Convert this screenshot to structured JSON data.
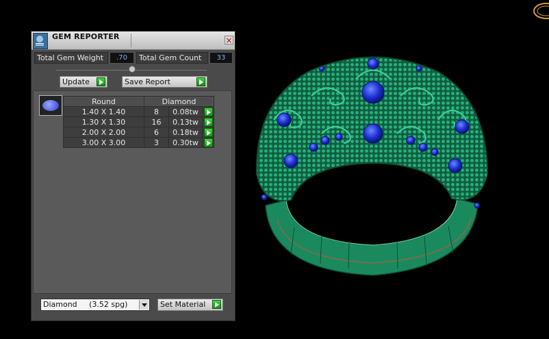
{
  "panel": {
    "title": "GEM REPORTER",
    "close_label": "×",
    "total_weight_label": "Total Gem Weight",
    "total_weight_value": ".70",
    "total_count_label": "Total Gem Count",
    "total_count_value": "33",
    "update_label": "Update",
    "save_report_label": "Save Report",
    "table": {
      "headers": [
        "Round",
        "Diamond"
      ],
      "rows": [
        {
          "size": "1.40 X 1.40",
          "count": "8",
          "weight": "0.08tw"
        },
        {
          "size": "1.30 X 1.30",
          "count": "16",
          "weight": "0.13tw"
        },
        {
          "size": "2.00 X 2.00",
          "count": "6",
          "weight": "0.18tw"
        },
        {
          "size": "3.00 X 3.00",
          "count": "3",
          "weight": "0.30tw"
        }
      ]
    },
    "material_selected": "Diamond     (3.52 spg)",
    "set_material_label": "Set Material"
  },
  "colors": {
    "ring_green": "#1f9a6a",
    "gem_blue": "#1a2fd0",
    "go_green": "#22a322",
    "value_text": "#7fb3ff"
  },
  "icons": {
    "title": "gem-reporter-icon",
    "close": "close-icon",
    "go": "play-arrow-icon",
    "gem": "round-gem-icon",
    "dropdown": "chevron-down-icon"
  }
}
